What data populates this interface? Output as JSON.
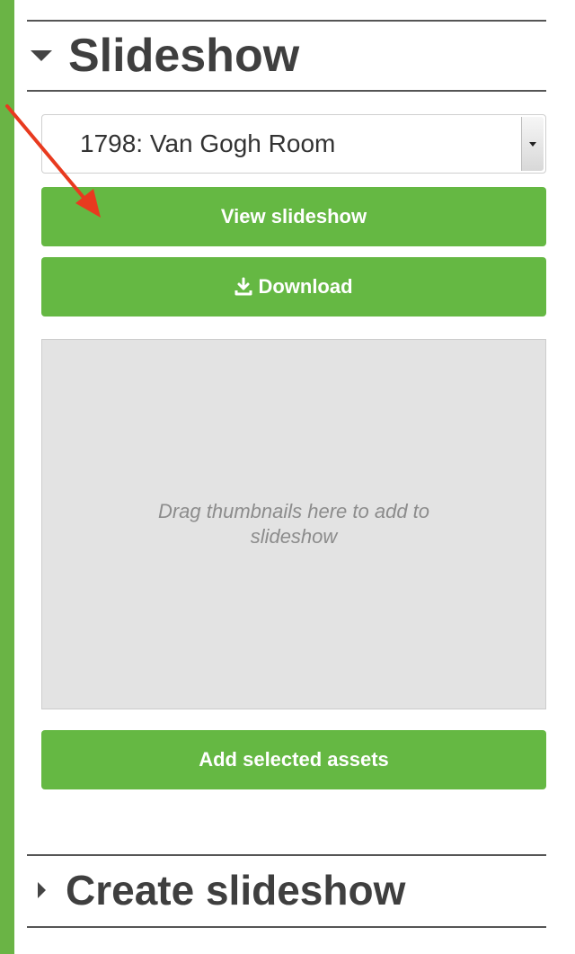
{
  "slideshow_section": {
    "title": "Slideshow",
    "select": {
      "value": "1798: Van Gogh Room"
    },
    "view_button_label": "View slideshow",
    "download_button_label": "Download",
    "dropzone_text": "Drag thumbnails here to add to slideshow",
    "add_button_label": "Add selected assets"
  },
  "create_section": {
    "title": "Create slideshow"
  },
  "colors": {
    "accent_green": "#65b843",
    "frame_green": "#6ab445",
    "annotation_arrow": "#e83a1f"
  },
  "icons": {
    "caret_open": "caret-down-icon",
    "caret_closed": "caret-right-icon",
    "download": "download-icon",
    "select_arrow": "select-arrow-icon"
  }
}
